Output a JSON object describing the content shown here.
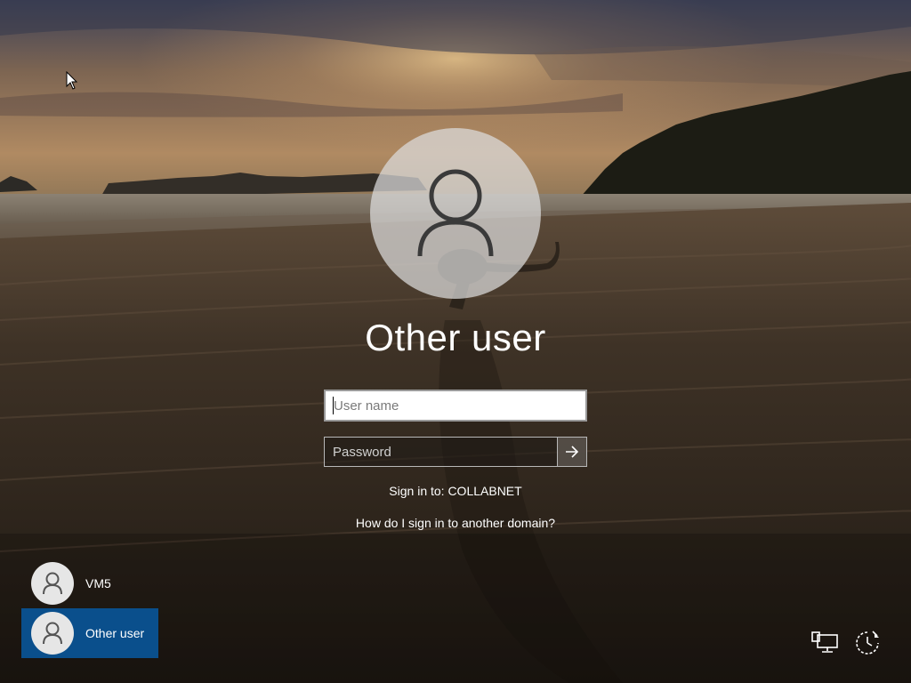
{
  "login": {
    "user_title": "Other user",
    "username_placeholder": "User name",
    "password_placeholder": "Password",
    "sign_in_to": "Sign in to: COLLABNET",
    "other_domain_link": "How do I sign in to another domain?"
  },
  "user_list": [
    {
      "label": "VM5",
      "selected": false
    },
    {
      "label": "Other user",
      "selected": true
    }
  ],
  "icons": {
    "avatar": "user-silhouette-icon",
    "submit": "arrow-right-icon",
    "network": "network-icon",
    "ease_of_access": "ease-of-access-icon"
  },
  "colors": {
    "selected_tile": "#0a4f8c",
    "avatar_circle": "#e6e6e6"
  }
}
